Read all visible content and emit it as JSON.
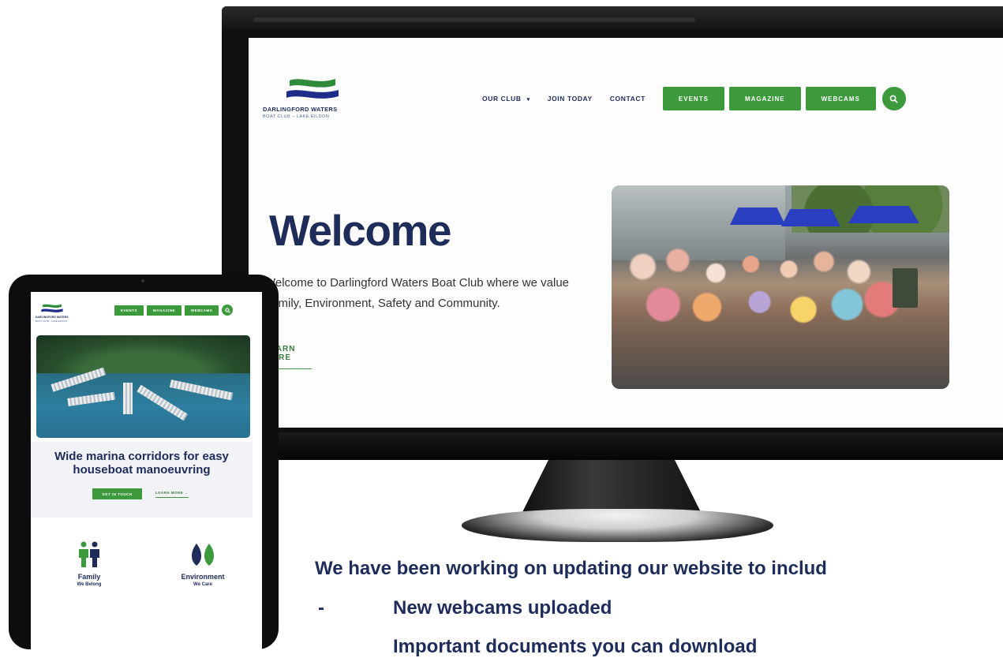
{
  "desktop": {
    "logo": {
      "name": "DARLINGFORD WATERS",
      "tagline": "BOAT CLUB – LAKE EILDON"
    },
    "nav": {
      "links": [
        "OUR CLUB",
        "JOIN TODAY",
        "CONTACT"
      ],
      "dropdown_icon": "chevron-down-icon",
      "buttons": [
        "EVENTS",
        "MAGAZINE",
        "WEBCAMS"
      ],
      "search_icon": "search-icon"
    },
    "hero": {
      "title": "Welcome",
      "intro": "Welcome to Darlingford Waters Boat Club where we value Family, Environment, Safety and Community.",
      "cta": "LEARN MORE"
    }
  },
  "tablet": {
    "logo": {
      "name": "DARLINGFORD WATERS",
      "tagline": "BOAT CLUB – LAKE EILDON"
    },
    "nav": {
      "buttons": [
        "EVENTS",
        "MAGAZINE",
        "WEBCAMS"
      ],
      "search_icon": "search-icon"
    },
    "headline": "Wide marina corridors for easy houseboat manoeuvring",
    "cta_primary": "GET IN TOUCH",
    "cta_secondary": "LEARN MORE →",
    "features": [
      {
        "title": "Family",
        "subtitle": "We Belong",
        "icon": "family-icon"
      },
      {
        "title": "Environment",
        "subtitle": "We Care",
        "icon": "leaf-icon"
      }
    ]
  },
  "announcement": {
    "heading": "We have been working on updating our website to includ",
    "bullet_marker": "-",
    "items": [
      "New webcams uploaded",
      "Important documents you can download"
    ]
  },
  "colors": {
    "brand_navy": "#1e2c5a",
    "brand_green": "#3c9a3c"
  }
}
